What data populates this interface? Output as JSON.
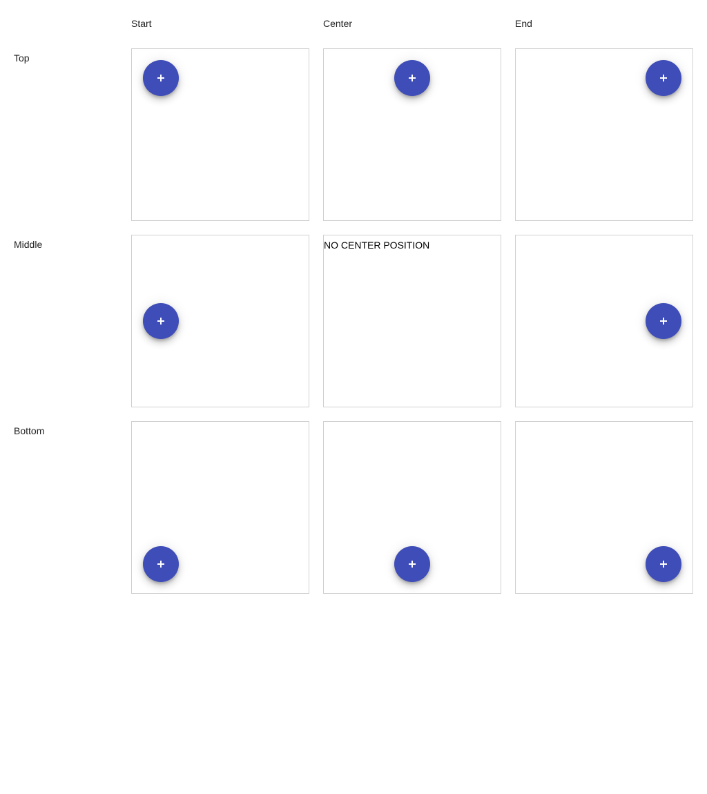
{
  "columns": [
    "Start",
    "Center",
    "End"
  ],
  "rows": [
    "Top",
    "Middle",
    "Bottom"
  ],
  "fab": {
    "icon": "plus-icon",
    "color": "#3f4db8"
  },
  "cells": {
    "middle_center_note": "NO CENTER POSITION"
  }
}
